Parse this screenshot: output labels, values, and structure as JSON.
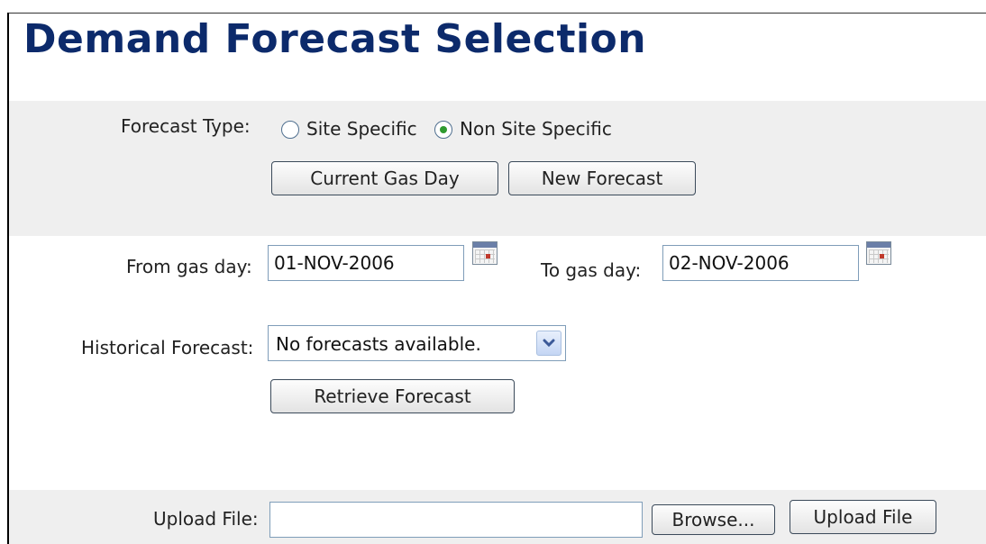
{
  "page": {
    "title": "Demand Forecast Selection"
  },
  "forecast_type": {
    "label": "Forecast Type:",
    "options": [
      {
        "label": "Site Specific",
        "selected": false
      },
      {
        "label": "Non Site Specific",
        "selected": true
      }
    ]
  },
  "actions": {
    "current_gas_day": "Current Gas Day",
    "new_forecast": "New Forecast"
  },
  "date_range": {
    "from_label": "From gas day:",
    "from_value": "01-NOV-2006",
    "to_label": "To gas day:",
    "to_value": "02-NOV-2006",
    "calendar_icon": "calendar-icon"
  },
  "historical": {
    "label": "Historical Forecast:",
    "selected": "No forecasts available.",
    "retrieve": "Retrieve Forecast"
  },
  "upload": {
    "label": "Upload File:",
    "value": "",
    "browse": "Browse...",
    "submit": "Upload File"
  },
  "colors": {
    "title": "#0c2a6b",
    "band": "#efefef",
    "radio_dot": "#2f9a2f"
  }
}
